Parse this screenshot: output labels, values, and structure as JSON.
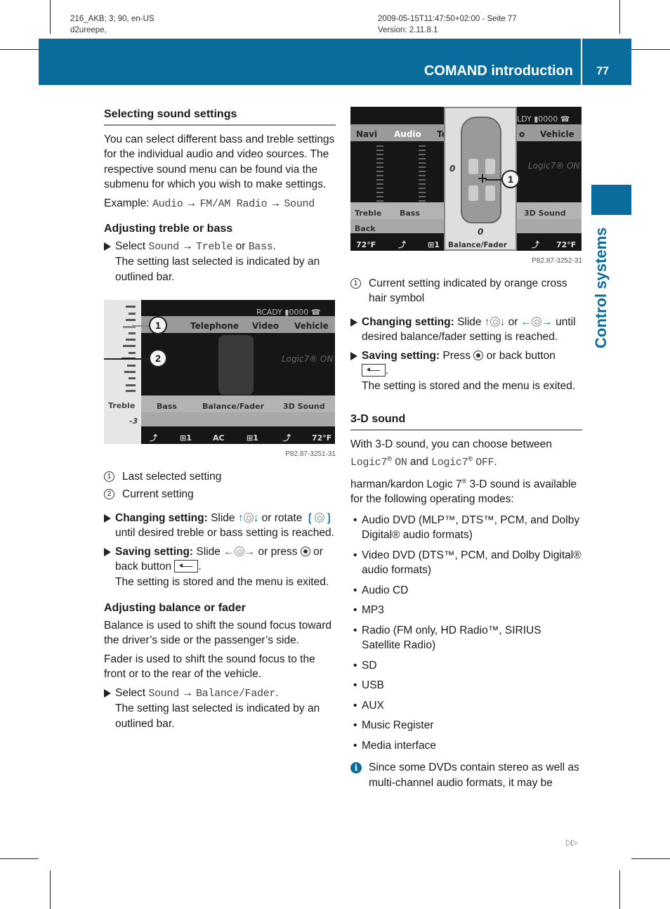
{
  "meta": {
    "left_line1": "216_AKB; 3; 90, en-US",
    "left_line2": "d2ureepe,",
    "right_line1": "2009-05-15T11:47:50+02:00 - Seite 77",
    "right_line2": "Version: 2.11.8.1"
  },
  "header": {
    "title": "COMAND introduction",
    "page_number": "77"
  },
  "side_tab": {
    "label": "Control systems"
  },
  "colors": {
    "brand_blue": "#0a6c9c",
    "rule_gray": "#8a8a8a"
  },
  "left": {
    "sound_settings": {
      "heading": "Selecting sound settings",
      "intro": "You can select different bass and treble settings for the individual audio and video sources. The respective sound menu can be found via the submenu for which you wish to make settings.",
      "example_label": "Example:",
      "example_path": [
        "Audio",
        "FM/AM Radio",
        "Sound"
      ],
      "arrow": "→"
    },
    "treble_bass": {
      "heading": "Adjusting treble or bass",
      "select_word": "Select",
      "path_sound": "Sound",
      "path_treble": "Treble",
      "or_word": "or",
      "path_bass": "Bass",
      "period": ".",
      "note": "The setting last selected is indicated by an outlined bar."
    },
    "figure1": {
      "status": "RCADY ▮0000 ☎",
      "menu": [
        "Telephone",
        "Video",
        "Vehicle"
      ],
      "logic": "Logic7® ON",
      "softkeys": [
        "Bass",
        "Balance/Fader",
        "3D Sound"
      ],
      "scale_label": "Treble",
      "scale_value": "-3",
      "climate": [
        "⤴",
        "⊞1",
        "AC",
        "⊞1",
        "⤴",
        "72°F"
      ],
      "callouts": [
        "1",
        "2"
      ],
      "code": "P82.87-3251-31"
    },
    "legend": [
      {
        "num": "1",
        "text": "Last selected setting"
      },
      {
        "num": "2",
        "text": "Current setting"
      }
    ],
    "changing": {
      "label": "Changing setting:",
      "text1": "Slide",
      "text2": "or rotate",
      "text3": "until desired treble or bass setting is reached."
    },
    "saving": {
      "label": "Saving setting:",
      "text1": "Slide",
      "text2": "or press",
      "text3": "or back button",
      "period": ".",
      "note": "The setting is stored and the menu is exited."
    },
    "balance_fader": {
      "heading": "Adjusting balance or fader",
      "p1": "Balance is used to shift the sound focus toward the driver’s side or the passenger’s side.",
      "p2": "Fader is used to shift the sound focus to the front or to the rear of the vehicle.",
      "select_word": "Select",
      "path_sound": "Sound",
      "path_balance": "Balance/Fader",
      "period": ".",
      "note": "The setting last selected is indicated by an outlined bar."
    }
  },
  "right": {
    "figure2": {
      "status": "LDY ▮0000 ☎",
      "menu": [
        "Navi",
        "Audio",
        "Te",
        "o",
        "Vehicle"
      ],
      "logic": "Logic7® ON",
      "softkeys": [
        "Treble",
        "Bass",
        "3D Sound"
      ],
      "softkeys2": [
        "Back"
      ],
      "climate": [
        "72°F",
        "⤴",
        "⊞1",
        "⤴",
        "72°F"
      ],
      "popup_label": "Balance/Fader",
      "popup_zero_left": "0",
      "popup_zero_bottom": "0",
      "callout": "1",
      "code": "P82.87-3252-31"
    },
    "legend": [
      {
        "num": "1",
        "text": "Current setting indicated by orange cross hair symbol"
      }
    ],
    "changing": {
      "label": "Changing setting:",
      "text1": "Slide",
      "text2": "or",
      "text3": "until desired balance/fader setting is reached."
    },
    "saving": {
      "label": "Saving setting:",
      "text1": "Press",
      "text2": "or back button",
      "period": ".",
      "note": "The setting is stored and the menu is exited."
    },
    "three_d": {
      "heading": "3-D sound",
      "p1_a": "With 3-D sound, you can choose between",
      "logic_on": "Logic7",
      "on": "ON",
      "and": "and",
      "logic_off": "Logic7",
      "off": "OFF",
      "reg": "®",
      "p2_a": "harman/kardon Logic 7",
      "p2_b": "3-D sound is available for the following operating modes:",
      "modes": [
        "Audio DVD (MLP™, DTS™, PCM, and Dolby Digital® audio formats)",
        "Video DVD (DTS™, PCM, and Dolby Digital® audio formats)",
        "Audio CD",
        "MP3",
        "Radio (FM only, HD Radio™, SIRIUS Satellite Radio)",
        "SD",
        "USB",
        "AUX",
        "Music Register",
        "Media interface"
      ],
      "info_icon": "i",
      "info_text": "Since some DVDs contain stereo as well as multi-channel audio formats, it may be"
    }
  },
  "footer": {
    "continue_symbol": "▷▷"
  }
}
